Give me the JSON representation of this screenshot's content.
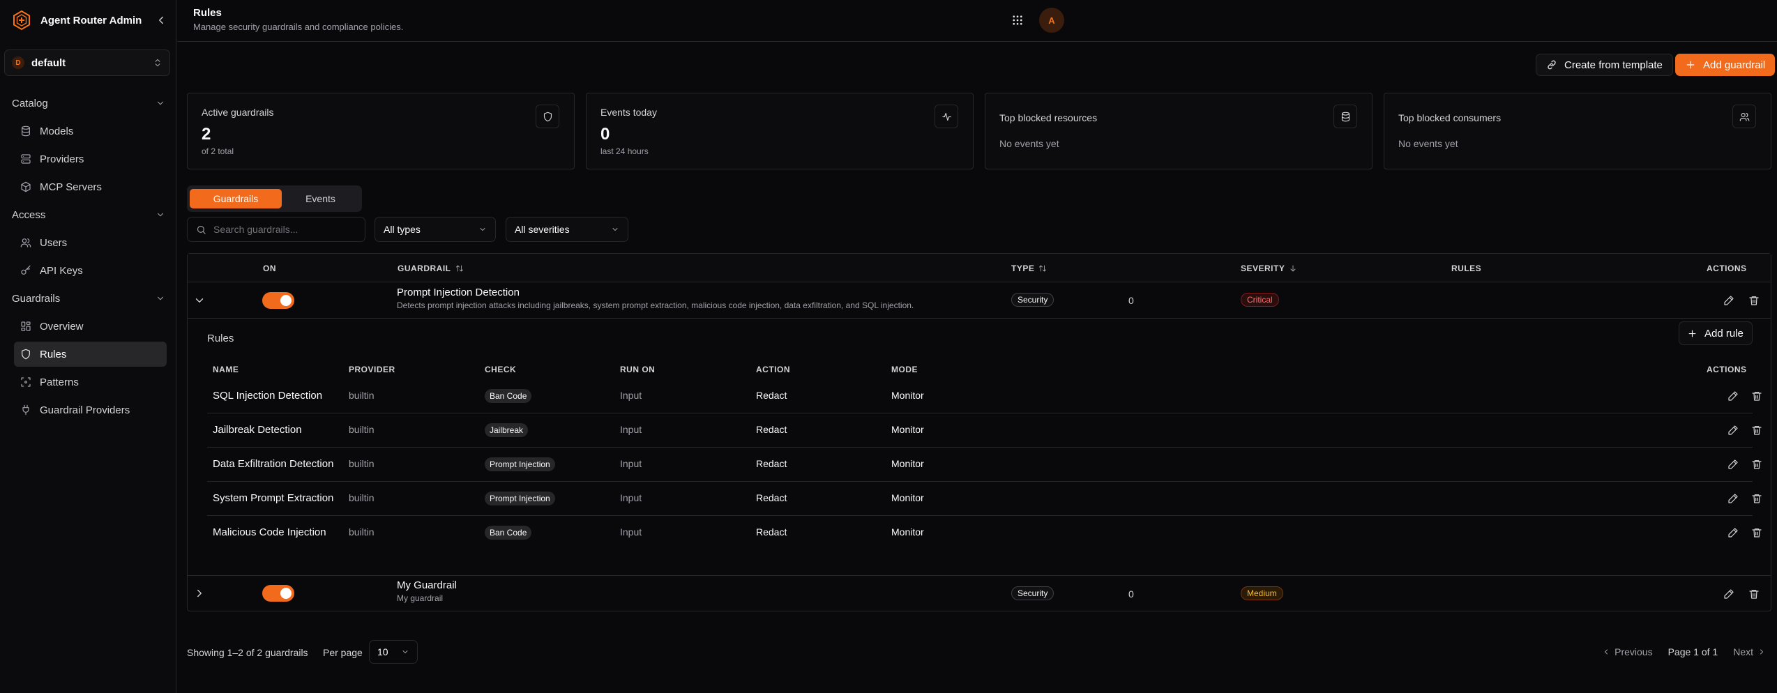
{
  "app": {
    "title": "Agent Router Admin",
    "logo_icon": "hexagon-logo-icon",
    "accent": "#f26b1d"
  },
  "workspace": {
    "initial": "D",
    "name": "default"
  },
  "sidebar": {
    "sections": [
      {
        "title": "Catalog",
        "items": [
          {
            "label": "Models",
            "icon": "database-icon"
          },
          {
            "label": "Providers",
            "icon": "server-icon"
          },
          {
            "label": "MCP Servers",
            "icon": "box-icon"
          }
        ]
      },
      {
        "title": "Access",
        "items": [
          {
            "label": "Users",
            "icon": "users-icon"
          },
          {
            "label": "API Keys",
            "icon": "key-icon"
          }
        ]
      },
      {
        "title": "Guardrails",
        "items": [
          {
            "label": "Overview",
            "icon": "dashboard-icon"
          },
          {
            "label": "Rules",
            "icon": "shield-icon",
            "active": true
          },
          {
            "label": "Patterns",
            "icon": "scan-icon"
          },
          {
            "label": "Guardrail Providers",
            "icon": "plug-icon"
          }
        ]
      }
    ]
  },
  "header": {
    "title": "Rules",
    "subtitle": "Manage security guardrails and compliance policies.",
    "avatar": "A"
  },
  "actions": {
    "create_template": "Create from template",
    "add_guardrail": "Add guardrail"
  },
  "stats": [
    {
      "title": "Active guardrails",
      "value": "2",
      "sub": "of 2 total",
      "icon": "shield-icon"
    },
    {
      "title": "Events today",
      "value": "0",
      "sub": "last 24 hours",
      "icon": "activity-icon"
    },
    {
      "title": "Top blocked resources",
      "empty": "No events yet",
      "icon": "database-icon"
    },
    {
      "title": "Top blocked consumers",
      "empty": "No events yet",
      "icon": "users-icon"
    }
  ],
  "tabs": [
    {
      "label": "Guardrails",
      "active": true
    },
    {
      "label": "Events"
    }
  ],
  "filters": {
    "search_placeholder": "Search guardrails...",
    "type": "All types",
    "severity": "All severities"
  },
  "table": {
    "columns": {
      "on": "ON",
      "guardrail": "GUARDRAIL",
      "type": "TYPE",
      "severity": "SEVERITY",
      "rules": "RULES",
      "actions": "ACTIONS"
    },
    "rows": [
      {
        "name": "Prompt Injection Detection",
        "description": "Detects prompt injection attacks including jailbreaks, system prompt extraction, malicious code injection, data exfiltration, and SQL injection.",
        "enabled": true,
        "type": "Security",
        "severity": "Critical",
        "rules": "0",
        "expanded": true
      },
      {
        "name": "My Guardrail",
        "description": "My guardrail",
        "enabled": true,
        "type": "Security",
        "severity": "Medium",
        "rules": "0",
        "expanded": false
      }
    ]
  },
  "rules_panel": {
    "title": "Rules",
    "add_label": "Add rule",
    "columns": {
      "name": "NAME",
      "provider": "PROVIDER",
      "check": "CHECK",
      "run_on": "RUN ON",
      "action": "ACTION",
      "mode": "MODE",
      "actions": "ACTIONS"
    },
    "rows": [
      {
        "name": "SQL Injection Detection",
        "provider": "builtin",
        "check": "Ban Code",
        "run_on": "Input",
        "action": "Redact",
        "mode": "Monitor"
      },
      {
        "name": "Jailbreak Detection",
        "provider": "builtin",
        "check": "Jailbreak",
        "run_on": "Input",
        "action": "Redact",
        "mode": "Monitor"
      },
      {
        "name": "Data Exfiltration Detection",
        "provider": "builtin",
        "check": "Prompt Injection",
        "run_on": "Input",
        "action": "Redact",
        "mode": "Monitor"
      },
      {
        "name": "System Prompt Extraction",
        "provider": "builtin",
        "check": "Prompt Injection",
        "run_on": "Input",
        "action": "Redact",
        "mode": "Monitor"
      },
      {
        "name": "Malicious Code Injection",
        "provider": "builtin",
        "check": "Ban Code",
        "run_on": "Input",
        "action": "Redact",
        "mode": "Monitor"
      }
    ]
  },
  "footer": {
    "showing": "Showing 1–2 of 2 guardrails",
    "per_page_label": "Per page",
    "per_page": "10",
    "previous": "Previous",
    "page_info": "Page 1 of 1",
    "next": "Next"
  }
}
